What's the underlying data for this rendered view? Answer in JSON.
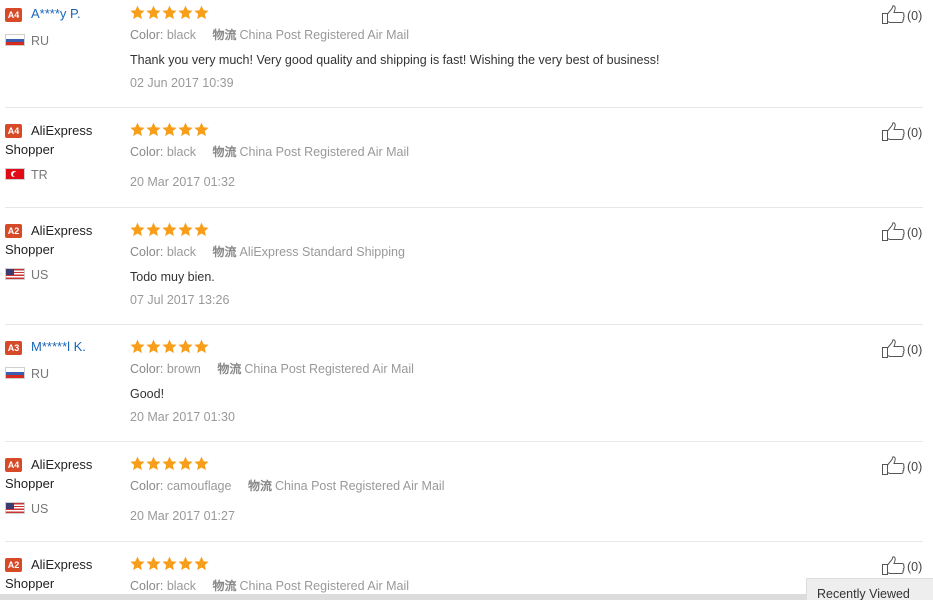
{
  "colors": {
    "badge": "#d64a28",
    "star": "#f79e1b",
    "masked_name": "#1a66b8"
  },
  "icons": {
    "star": "star-icon",
    "like": "thumbs-up-icon"
  },
  "labels": {
    "color": "Color:",
    "shipping": "物流"
  },
  "reviews": [
    {
      "level": "A4",
      "name": "A****y P.",
      "name_masked": true,
      "flag": "ru",
      "country": "RU",
      "rating": 5,
      "color": "black",
      "shipping": "China Post Registered Air Mail",
      "text": "Thank you very much! Very good quality and shipping is fast! Wishing the very best of business!",
      "date": "02 Jun 2017 10:39",
      "likes": "(0)"
    },
    {
      "level": "A4",
      "name_line1": "AliExpress",
      "name_line2": "Shopper",
      "flag": "tr",
      "country": "TR",
      "rating": 5,
      "color": "black",
      "shipping": "China Post Registered Air Mail",
      "text": "",
      "date": "20 Mar 2017 01:32",
      "likes": "(0)"
    },
    {
      "level": "A2",
      "name_line1": "AliExpress",
      "name_line2": "Shopper",
      "flag": "us",
      "country": "US",
      "rating": 5,
      "color": "black",
      "shipping": "AliExpress Standard Shipping",
      "text": "Todo muy bien.",
      "date": "07 Jul 2017 13:26",
      "likes": "(0)"
    },
    {
      "level": "A3",
      "name": "M*****l K.",
      "name_masked": true,
      "flag": "ru",
      "country": "RU",
      "rating": 5,
      "color": "brown",
      "shipping": "China Post Registered Air Mail",
      "text": "Good!",
      "date": "20 Mar 2017 01:30",
      "likes": "(0)"
    },
    {
      "level": "A4",
      "name_line1": "AliExpress",
      "name_line2": "Shopper",
      "flag": "us",
      "country": "US",
      "rating": 5,
      "color": "camouflage",
      "shipping": "China Post Registered Air Mail",
      "text": "",
      "date": "20 Mar 2017 01:27",
      "likes": "(0)"
    },
    {
      "level": "A2",
      "name_line1": "AliExpress",
      "name_line2": "Shopper",
      "rating": 5,
      "color": "black",
      "shipping": "China Post Registered Air Mail",
      "likes": "(0)"
    }
  ],
  "recently_viewed": "Recently Viewed"
}
